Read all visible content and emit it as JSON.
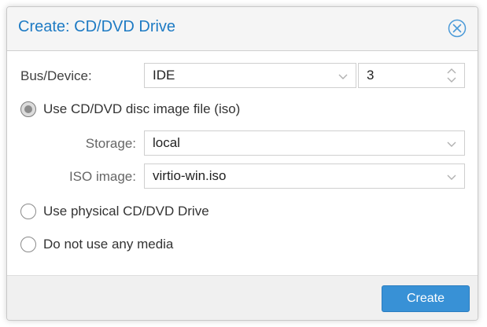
{
  "dialog": {
    "title": "Create: CD/DVD Drive",
    "close_icon": "close-circle-x-icon"
  },
  "bus_device": {
    "label": "Bus/Device:",
    "bus_value": "IDE",
    "device_value": "3"
  },
  "media_options": [
    {
      "label": "Use CD/DVD disc image file (iso)",
      "checked": true
    },
    {
      "label": "Use physical CD/DVD Drive",
      "checked": false
    },
    {
      "label": "Do not use any media",
      "checked": false
    }
  ],
  "storage": {
    "label": "Storage:",
    "value": "local"
  },
  "iso_image": {
    "label": "ISO image:",
    "value": "virtio-win.iso"
  },
  "footer": {
    "create_label": "Create"
  },
  "colors": {
    "title": "#1e7bc4",
    "button": "#3891d6",
    "radio_checked": "#8c8c8c"
  }
}
